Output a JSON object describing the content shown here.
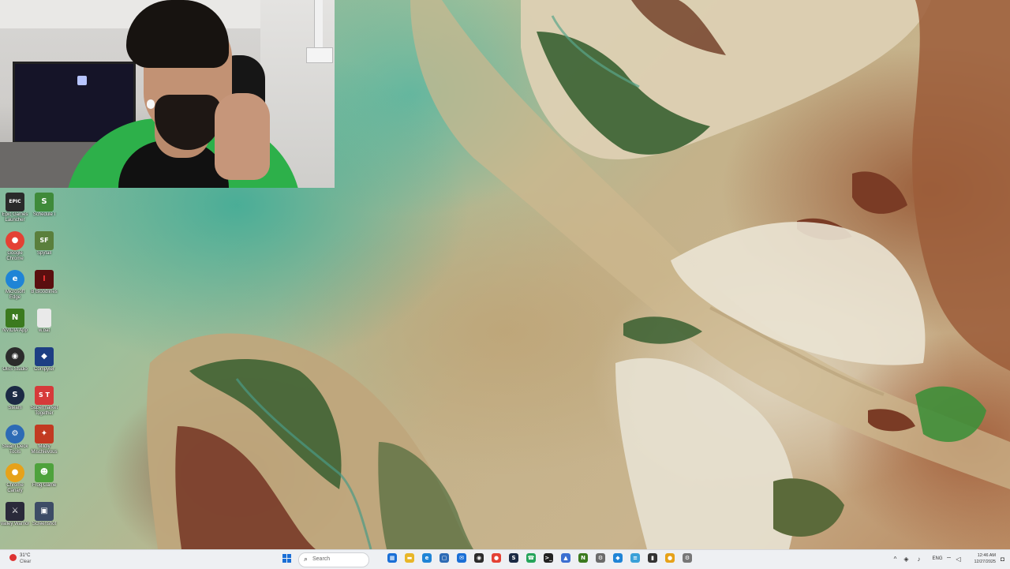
{
  "colors": {
    "taskbar_bg": "#eef0f3",
    "accent_blue": "#1a6fd6",
    "hoodie_green": "#2db04a",
    "label_text": "#ffffff"
  },
  "desktop_icons": [
    {
      "id": "epic",
      "label": "Epic Games Launcher",
      "glyph": "EPIC",
      "color": "#2a2a2a",
      "icon": "epic-games-icon"
    },
    {
      "id": "schedule1",
      "label": "Schedule I",
      "glyph": "S",
      "color": "#3f8a3a",
      "icon": "schedule-i-icon"
    },
    {
      "id": "chrome",
      "label": "Google Chrome",
      "glyph": "●",
      "color": "#e44134",
      "icon": "chrome-icon"
    },
    {
      "id": "spyfall",
      "label": "Spyfall",
      "glyph": "SF",
      "color": "#5a7f3c",
      "icon": "spyfall-icon"
    },
    {
      "id": "edge",
      "label": "Microsoft Edge",
      "glyph": "e",
      "color": "#1f84d6",
      "icon": "edge-icon"
    },
    {
      "id": "bloodlines",
      "label": "B Bloodlines",
      "glyph": "I",
      "color": "#5a0f0f",
      "icon": "bloodlines-icon"
    },
    {
      "id": "nvidia",
      "label": "NVIDIA App",
      "glyph": "N",
      "color": "#3b7a1e",
      "icon": "nvidia-icon"
    },
    {
      "id": "file",
      "label": "w.bat",
      "glyph": "",
      "color": "#e9e9e9",
      "icon": "file-icon"
    },
    {
      "id": "obs",
      "label": "OBS Studio",
      "glyph": "◉",
      "color": "#2b2b2b",
      "icon": "obs-icon"
    },
    {
      "id": "compyler",
      "label": "Compyler",
      "glyph": "◆",
      "color": "#1d3e83",
      "icon": "compyler-icon"
    },
    {
      "id": "steam",
      "label": "Steam",
      "glyph": "S",
      "color": "#1b2a44",
      "icon": "steam-icon"
    },
    {
      "id": "supermarket",
      "label": "Supermarket Together",
      "glyph": "S T",
      "color": "#d63a3a",
      "icon": "supermarket-together-icon"
    },
    {
      "id": "steamdeck",
      "label": "Steam Deck Tools",
      "glyph": "⚙",
      "color": "#2d6bb5",
      "icon": "gear-icon"
    },
    {
      "id": "fowl",
      "label": "Mildly Mischievous",
      "glyph": "✦",
      "color": "#c23a21",
      "icon": "game-icon"
    },
    {
      "id": "chrome2",
      "label": "Chrome Canary",
      "glyph": "●",
      "color": "#e6a21a",
      "icon": "chrome-canary-icon"
    },
    {
      "id": "frog",
      "label": "Frog Game",
      "glyph": "☻",
      "color": "#4ea23c",
      "icon": "frog-icon"
    },
    {
      "id": "vvv",
      "label": "Valley Warrior",
      "glyph": "⚔",
      "color": "#2a2a3a",
      "icon": "sword-icon"
    },
    {
      "id": "photo",
      "label": "Screenshot",
      "glyph": "▣",
      "color": "#3d4c66",
      "icon": "image-icon"
    }
  ],
  "taskbar": {
    "weather_temp": "31°C",
    "weather_cond": "Clear",
    "search_placeholder": "Search",
    "pinned": [
      {
        "icon": "widgets-icon",
        "glyph": "▦",
        "color": "#1a6fd6"
      },
      {
        "icon": "file-explorer-icon",
        "glyph": "▬",
        "color": "#e8b628"
      },
      {
        "icon": "edge-icon",
        "glyph": "e",
        "color": "#1f84d6"
      },
      {
        "icon": "store-icon",
        "glyph": "▢",
        "color": "#2d6bb5"
      },
      {
        "icon": "mail-icon",
        "glyph": "✉",
        "color": "#1a6fd6"
      },
      {
        "icon": "obs-icon",
        "glyph": "◉",
        "color": "#2b2b2b"
      },
      {
        "icon": "chrome-icon",
        "glyph": "●",
        "color": "#e44134"
      },
      {
        "icon": "steam-icon",
        "glyph": "S",
        "color": "#1b2a44"
      },
      {
        "icon": "whatsapp-icon",
        "glyph": "☎",
        "color": "#25a45a"
      },
      {
        "icon": "terminal-icon",
        "glyph": ">_",
        "color": "#222222"
      },
      {
        "icon": "photos-icon",
        "glyph": "▲",
        "color": "#3b6fd1"
      },
      {
        "icon": "nvidia-icon",
        "glyph": "N",
        "color": "#3b7a1e"
      },
      {
        "icon": "settings-icon",
        "glyph": "⚙",
        "color": "#6b6b6b"
      },
      {
        "icon": "shield-icon",
        "glyph": "◆",
        "color": "#1f84d6"
      },
      {
        "icon": "notepad-icon",
        "glyph": "≡",
        "color": "#3aa0d8"
      },
      {
        "icon": "media-icon",
        "glyph": "▮",
        "color": "#333333"
      },
      {
        "icon": "chrome-canary-icon",
        "glyph": "●",
        "color": "#e6a21a"
      },
      {
        "icon": "capture-icon",
        "glyph": "⚙",
        "color": "#777777"
      }
    ],
    "language": "ENG",
    "time": "12:46 AM",
    "date": "12/27/2025"
  }
}
